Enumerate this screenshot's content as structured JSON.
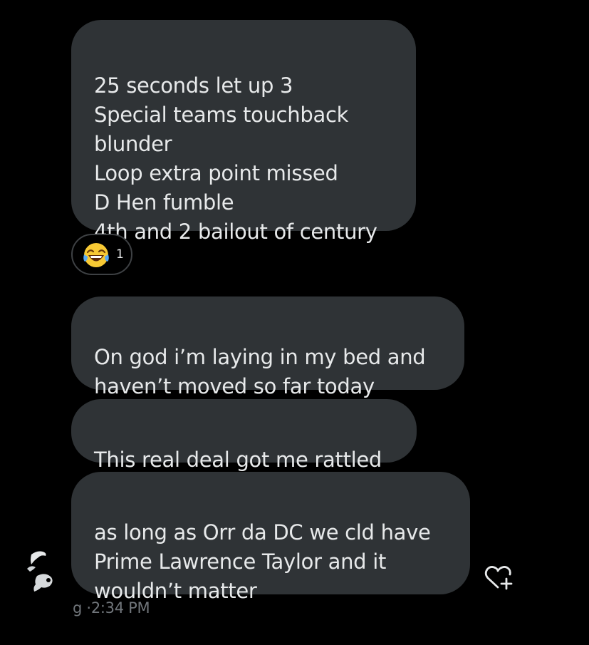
{
  "messages": [
    {
      "text": "25 seconds let up 3\nSpecial teams touchback blunder\nLoop extra point missed\nD Hen fumble\n4th and 2 bailout of century"
    },
    {
      "text": "On god i’m laying in my bed and haven’t moved so far today"
    },
    {
      "text": "This real deal got me rattled"
    },
    {
      "text": "as long as Orr da DC we cld have Prime Lawrence Taylor and it wouldn’t matter"
    }
  ],
  "reaction": {
    "emoji": "face-with-tears-of-joy",
    "count": "1"
  },
  "meta": {
    "sender": "g",
    "separator": "·",
    "time": "2:34 PM"
  },
  "colors": {
    "background": "#000000",
    "bubble": "#2f3336",
    "text": "#e7e9ea",
    "muted": "#71767b"
  }
}
